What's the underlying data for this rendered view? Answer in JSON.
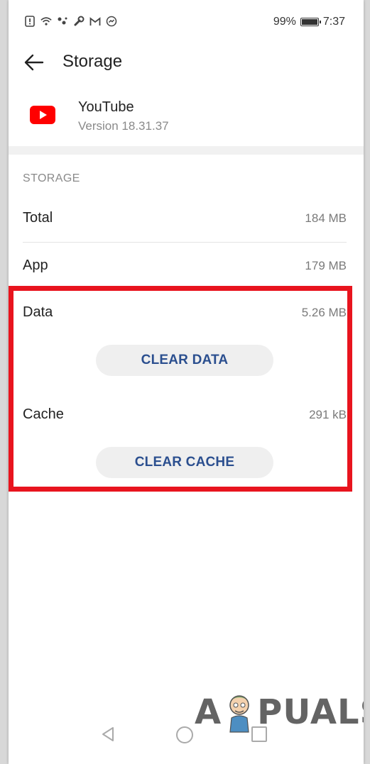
{
  "status_bar": {
    "battery": "99%",
    "time": "7:37",
    "icons": [
      "alert-icon",
      "wifi-icon",
      "dots-icon",
      "wrench-icon",
      "gmail-icon",
      "messenger-icon"
    ]
  },
  "header": {
    "title": "Storage"
  },
  "app": {
    "name": "YouTube",
    "version": "Version 18.31.37",
    "icon": "youtube-icon",
    "brand_color": "#ff0000"
  },
  "storage": {
    "section_title": "STORAGE",
    "total": {
      "label": "Total",
      "value": "184 MB"
    },
    "app": {
      "label": "App",
      "value": "179 MB"
    },
    "data": {
      "label": "Data",
      "value": "5.26 MB",
      "button": "CLEAR DATA"
    },
    "cache": {
      "label": "Cache",
      "value": "291 kB",
      "button": "CLEAR CACHE"
    }
  },
  "highlight_color": "#e8141e",
  "watermark": {
    "text_left": "A",
    "text_right": "PUALS"
  }
}
